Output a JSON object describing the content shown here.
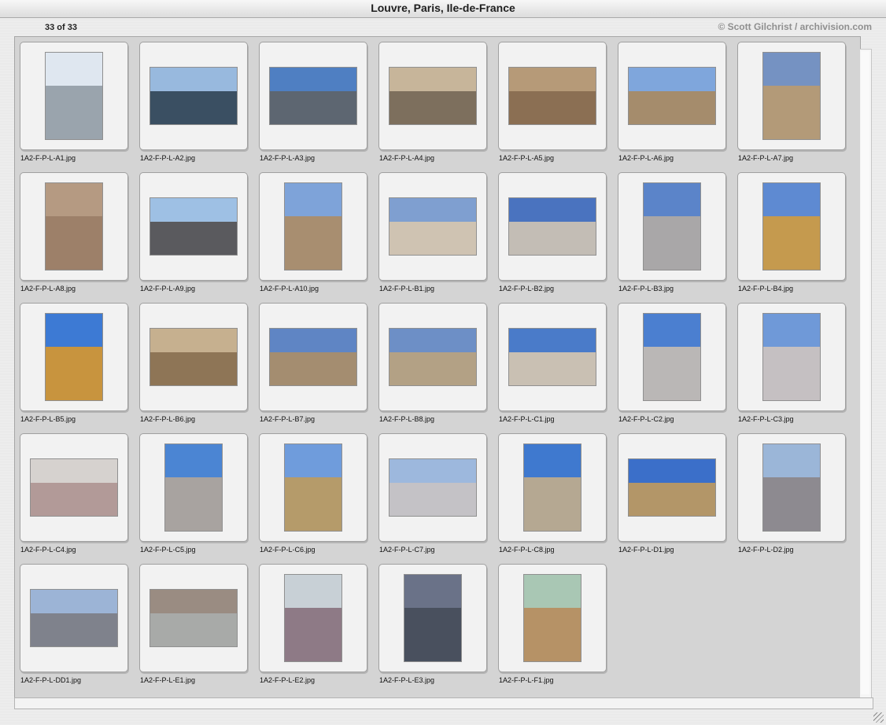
{
  "window": {
    "title": "Louvre, Paris, Ile-de-France"
  },
  "header": {
    "count": "33 of 33",
    "credit": "© Scott Gilchrist / archivision.com"
  },
  "thumbnails": [
    {
      "name": "1A2-F-P-L-A1.jpg",
      "orient": "port",
      "sky": "#dfe7f0",
      "ground": "#9aa4ad",
      "subject": "pavilion"
    },
    {
      "name": "1A2-F-P-L-A2.jpg",
      "orient": "land",
      "sky": "#98b9de",
      "ground": "#3a4f62",
      "subject": "river-bridge"
    },
    {
      "name": "1A2-F-P-L-A3.jpg",
      "orient": "land",
      "sky": "#4f7fc2",
      "ground": "#5d6671",
      "subject": "facade-road"
    },
    {
      "name": "1A2-F-P-L-A4.jpg",
      "orient": "land",
      "sky": "#c7b59a",
      "ground": "#7d6f5d",
      "subject": "arch"
    },
    {
      "name": "1A2-F-P-L-A5.jpg",
      "orient": "land",
      "sky": "#b69a78",
      "ground": "#8b6f53",
      "subject": "facade-detail"
    },
    {
      "name": "1A2-F-P-L-A6.jpg",
      "orient": "land",
      "sky": "#7fa6dc",
      "ground": "#a58c6c",
      "subject": "clock-roof"
    },
    {
      "name": "1A2-F-P-L-A7.jpg",
      "orient": "port",
      "sky": "#7592c2",
      "ground": "#b39a78",
      "subject": "pavilion-wall"
    },
    {
      "name": "1A2-F-P-L-A8.jpg",
      "orient": "port",
      "sky": "#b59a82",
      "ground": "#9d8069",
      "subject": "facade-detail"
    },
    {
      "name": "1A2-F-P-L-A9.jpg",
      "orient": "land",
      "sky": "#9ec0e4",
      "ground": "#5a5a5e",
      "subject": "long-wing"
    },
    {
      "name": "1A2-F-P-L-A10.jpg",
      "orient": "port",
      "sky": "#7ea3d9",
      "ground": "#a88e70",
      "subject": "facade-detail"
    },
    {
      "name": "1A2-F-P-L-B1.jpg",
      "orient": "land",
      "sky": "#7f9fd0",
      "ground": "#cfc3b2",
      "subject": "courtyard-pyramid"
    },
    {
      "name": "1A2-F-P-L-B2.jpg",
      "orient": "land",
      "sky": "#4a73bf",
      "ground": "#c3bdb5",
      "subject": "courtyard"
    },
    {
      "name": "1A2-F-P-L-B3.jpg",
      "orient": "port",
      "sky": "#5b84c9",
      "ground": "#a9a7a8",
      "subject": "pavilion"
    },
    {
      "name": "1A2-F-P-L-B4.jpg",
      "orient": "port",
      "sky": "#5e8ad2",
      "ground": "#c59a4e",
      "subject": "golden-facade"
    },
    {
      "name": "1A2-F-P-L-B5.jpg",
      "orient": "port",
      "sky": "#3d7ad4",
      "ground": "#c8943e",
      "subject": "golden-facade"
    },
    {
      "name": "1A2-F-P-L-B6.jpg",
      "orient": "land",
      "sky": "#c6b08f",
      "ground": "#8e7556",
      "subject": "columns"
    },
    {
      "name": "1A2-F-P-L-B7.jpg",
      "orient": "land",
      "sky": "#5f85c4",
      "ground": "#a48d70",
      "subject": "pediment"
    },
    {
      "name": "1A2-F-P-L-B8.jpg",
      "orient": "land",
      "sky": "#6d8fc6",
      "ground": "#b3a185",
      "subject": "pediment"
    },
    {
      "name": "1A2-F-P-L-C1.jpg",
      "orient": "land",
      "sky": "#4a7bc9",
      "ground": "#c9c0b3",
      "subject": "courtyard"
    },
    {
      "name": "1A2-F-P-L-C2.jpg",
      "orient": "port",
      "sky": "#4b7fd0",
      "ground": "#bab7b6",
      "subject": "pavilion"
    },
    {
      "name": "1A2-F-P-L-C3.jpg",
      "orient": "port",
      "sky": "#6f99d8",
      "ground": "#c5c0c2",
      "subject": "long-wing"
    },
    {
      "name": "1A2-F-P-L-C4.jpg",
      "orient": "land",
      "sky": "#d6d2cf",
      "ground": "#b29a98",
      "subject": "arcade"
    },
    {
      "name": "1A2-F-P-L-C5.jpg",
      "orient": "port",
      "sky": "#4b85d3",
      "ground": "#a8a3a0",
      "subject": "golden-facade"
    },
    {
      "name": "1A2-F-P-L-C6.jpg",
      "orient": "port",
      "sky": "#6f9cdc",
      "ground": "#b59b6a",
      "subject": "golden-facade"
    },
    {
      "name": "1A2-F-P-L-C7.jpg",
      "orient": "land",
      "sky": "#9db8dd",
      "ground": "#c4c2c6",
      "subject": "courtyard-pyramid"
    },
    {
      "name": "1A2-F-P-L-C8.jpg",
      "orient": "port",
      "sky": "#3f79cf",
      "ground": "#b5a892",
      "subject": "pavilion"
    },
    {
      "name": "1A2-F-P-L-D1.jpg",
      "orient": "land",
      "sky": "#3b6fc9",
      "ground": "#b39668",
      "subject": "arcade"
    },
    {
      "name": "1A2-F-P-L-D2.jpg",
      "orient": "port",
      "sky": "#9bb6d8",
      "ground": "#8d8a90",
      "subject": "facade-detail"
    },
    {
      "name": "1A2-F-P-L-DD1.jpg",
      "orient": "land",
      "sky": "#9cb4d6",
      "ground": "#7f828c",
      "subject": "city"
    },
    {
      "name": "1A2-F-P-L-E1.jpg",
      "orient": "land",
      "sky": "#9a8c82",
      "ground": "#a8aaa8",
      "subject": "garden-court"
    },
    {
      "name": "1A2-F-P-L-E2.jpg",
      "orient": "port",
      "sky": "#c8d0d6",
      "ground": "#8e7a86",
      "subject": "garden-court"
    },
    {
      "name": "1A2-F-P-L-E3.jpg",
      "orient": "port",
      "sky": "#6a7288",
      "ground": "#49505e",
      "subject": "facade-detail"
    },
    {
      "name": "1A2-F-P-L-F1.jpg",
      "orient": "port",
      "sky": "#a9c7b4",
      "ground": "#b69266",
      "subject": "gallery"
    }
  ]
}
